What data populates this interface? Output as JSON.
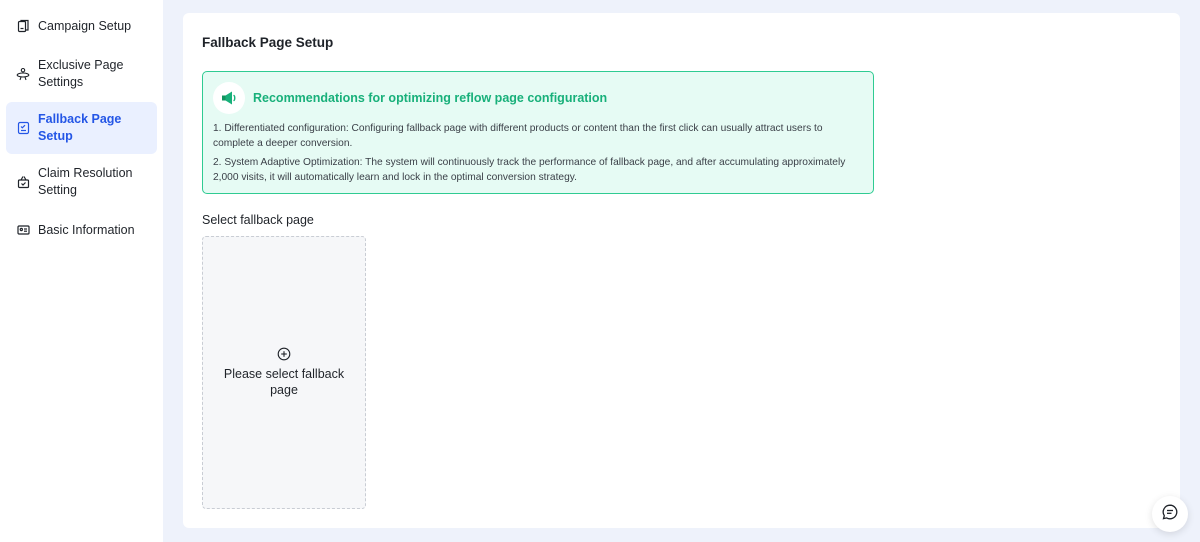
{
  "sidebar": {
    "items": [
      {
        "label": "Campaign Setup",
        "icon": "document-icon",
        "active": false
      },
      {
        "label": "Exclusive Page Settings",
        "icon": "robot-icon",
        "active": false
      },
      {
        "label": "Fallback Page Setup",
        "icon": "checklist-icon",
        "active": true
      },
      {
        "label": "Claim Resolution Setting",
        "icon": "gift-icon",
        "active": false
      },
      {
        "label": "Basic Information",
        "icon": "id-card-icon",
        "active": false
      }
    ]
  },
  "main": {
    "title": "Fallback Page Setup",
    "recommendation": {
      "icon": "megaphone-icon",
      "title": "Recommendations for optimizing reflow page configuration",
      "line1": "1. Differentiated configuration: Configuring fallback page with different products or content than the first click can usually attract users to complete a deeper conversion.",
      "line2": "2. System Adaptive Optimization: The system will continuously track the performance of fallback page, and after accumulating approximately 2,000 visits, it will automatically learn and lock in the optimal conversion strategy."
    },
    "select_label": "Select fallback page",
    "select_card": {
      "icon": "plus-circle-icon",
      "text": "Please select fallback page"
    }
  },
  "chat_button": {
    "icon": "chat-icon"
  },
  "colors": {
    "accent": "#2456e6",
    "active_bg": "#eaf0ff",
    "reco_border": "#2fcb92",
    "reco_bg": "#e6fbf4",
    "reco_title": "#18b07a",
    "page_bg": "#eef2fb"
  }
}
